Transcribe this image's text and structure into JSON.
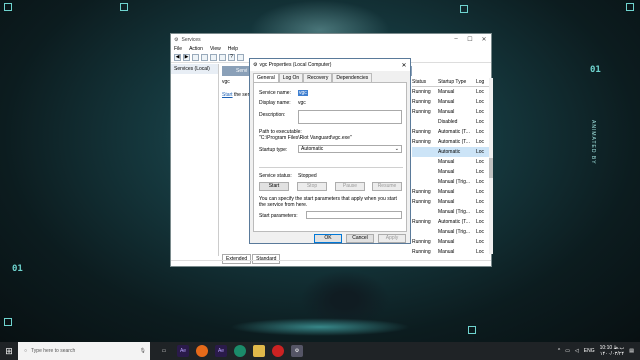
{
  "wallpaper": {
    "marks": [
      "01",
      "01"
    ],
    "vertical_text": "ANIMATED BY"
  },
  "services_window": {
    "title": "Services",
    "controls": [
      "–",
      "☐",
      "✕"
    ],
    "menu": [
      "File",
      "Action",
      "View",
      "Help"
    ],
    "left_pane_item": "Services (Local)",
    "header": "Servi",
    "service_name": "vgc",
    "start_prefix": "Start",
    "start_suffix": "the servi",
    "columns": [
      "Status",
      "Startup Type",
      "Log"
    ],
    "rows": [
      {
        "status": "Running",
        "startup": "Manual",
        "log": "Loc"
      },
      {
        "status": "Running",
        "startup": "Manual",
        "log": "Loc"
      },
      {
        "status": "Running",
        "startup": "Manual",
        "log": "Loc"
      },
      {
        "status": "",
        "startup": "Disabled",
        "log": "Loc"
      },
      {
        "status": "Running",
        "startup": "Automatic (T...",
        "log": "Loc"
      },
      {
        "status": "Running",
        "startup": "Automatic (T...",
        "log": "Loc"
      },
      {
        "status": "",
        "startup": "Automatic",
        "log": "Loc"
      },
      {
        "status": "",
        "startup": "Manual",
        "log": "Loc"
      },
      {
        "status": "",
        "startup": "Manual",
        "log": "Loc"
      },
      {
        "status": "",
        "startup": "Manual (Trig...",
        "log": "Loc"
      },
      {
        "status": "Running",
        "startup": "Manual",
        "log": "Loc"
      },
      {
        "status": "Running",
        "startup": "Manual",
        "log": "Loc"
      },
      {
        "status": "",
        "startup": "Manual (Trig...",
        "log": "Loc"
      },
      {
        "status": "Running",
        "startup": "Automatic (T...",
        "log": "Loc"
      },
      {
        "status": "",
        "startup": "Manual (Trig...",
        "log": "Loc"
      },
      {
        "status": "Running",
        "startup": "Manual",
        "log": "Loc"
      },
      {
        "status": "Running",
        "startup": "Manual",
        "log": "Loc"
      }
    ],
    "selected_row_index": 6,
    "bottom_tabs": [
      "Extended",
      "Standard"
    ]
  },
  "dialog": {
    "title": "vgc Properties (Local Computer)",
    "close": "✕",
    "tabs": [
      "General",
      "Log On",
      "Recovery",
      "Dependencies"
    ],
    "active_tab": 0,
    "service_name_label": "Service name:",
    "service_name_value": "vgc",
    "display_name_label": "Display name:",
    "display_name_value": "vgc",
    "description_label": "Description:",
    "path_label": "Path to executable:",
    "path_value": "\"C:\\Program Files\\Riot Vanguard\\vgc.exe\"",
    "startup_type_label": "Startup type:",
    "startup_type_value": "Automatic",
    "service_status_label": "Service status:",
    "service_status_value": "Stopped",
    "buttons": {
      "start": "Start",
      "stop": "Stop",
      "pause": "Pause",
      "resume": "Resume"
    },
    "hint": "You can specify the start parameters that apply when you start the service from here.",
    "start_params_label": "Start parameters:",
    "ok": "OK",
    "cancel": "Cancel",
    "apply": "Apply"
  },
  "taskbar": {
    "search_placeholder": "Type here to search",
    "icons": [
      "task-view-icon",
      "ae-icon",
      "firefox-icon",
      "ae-icon",
      "edge-icon",
      "file-explorer-icon",
      "record-icon",
      "services-icon"
    ],
    "language": "ENG",
    "time": "10:10 ب.ظ",
    "date": "۱۴۰۰/۰۳/۲۴"
  }
}
